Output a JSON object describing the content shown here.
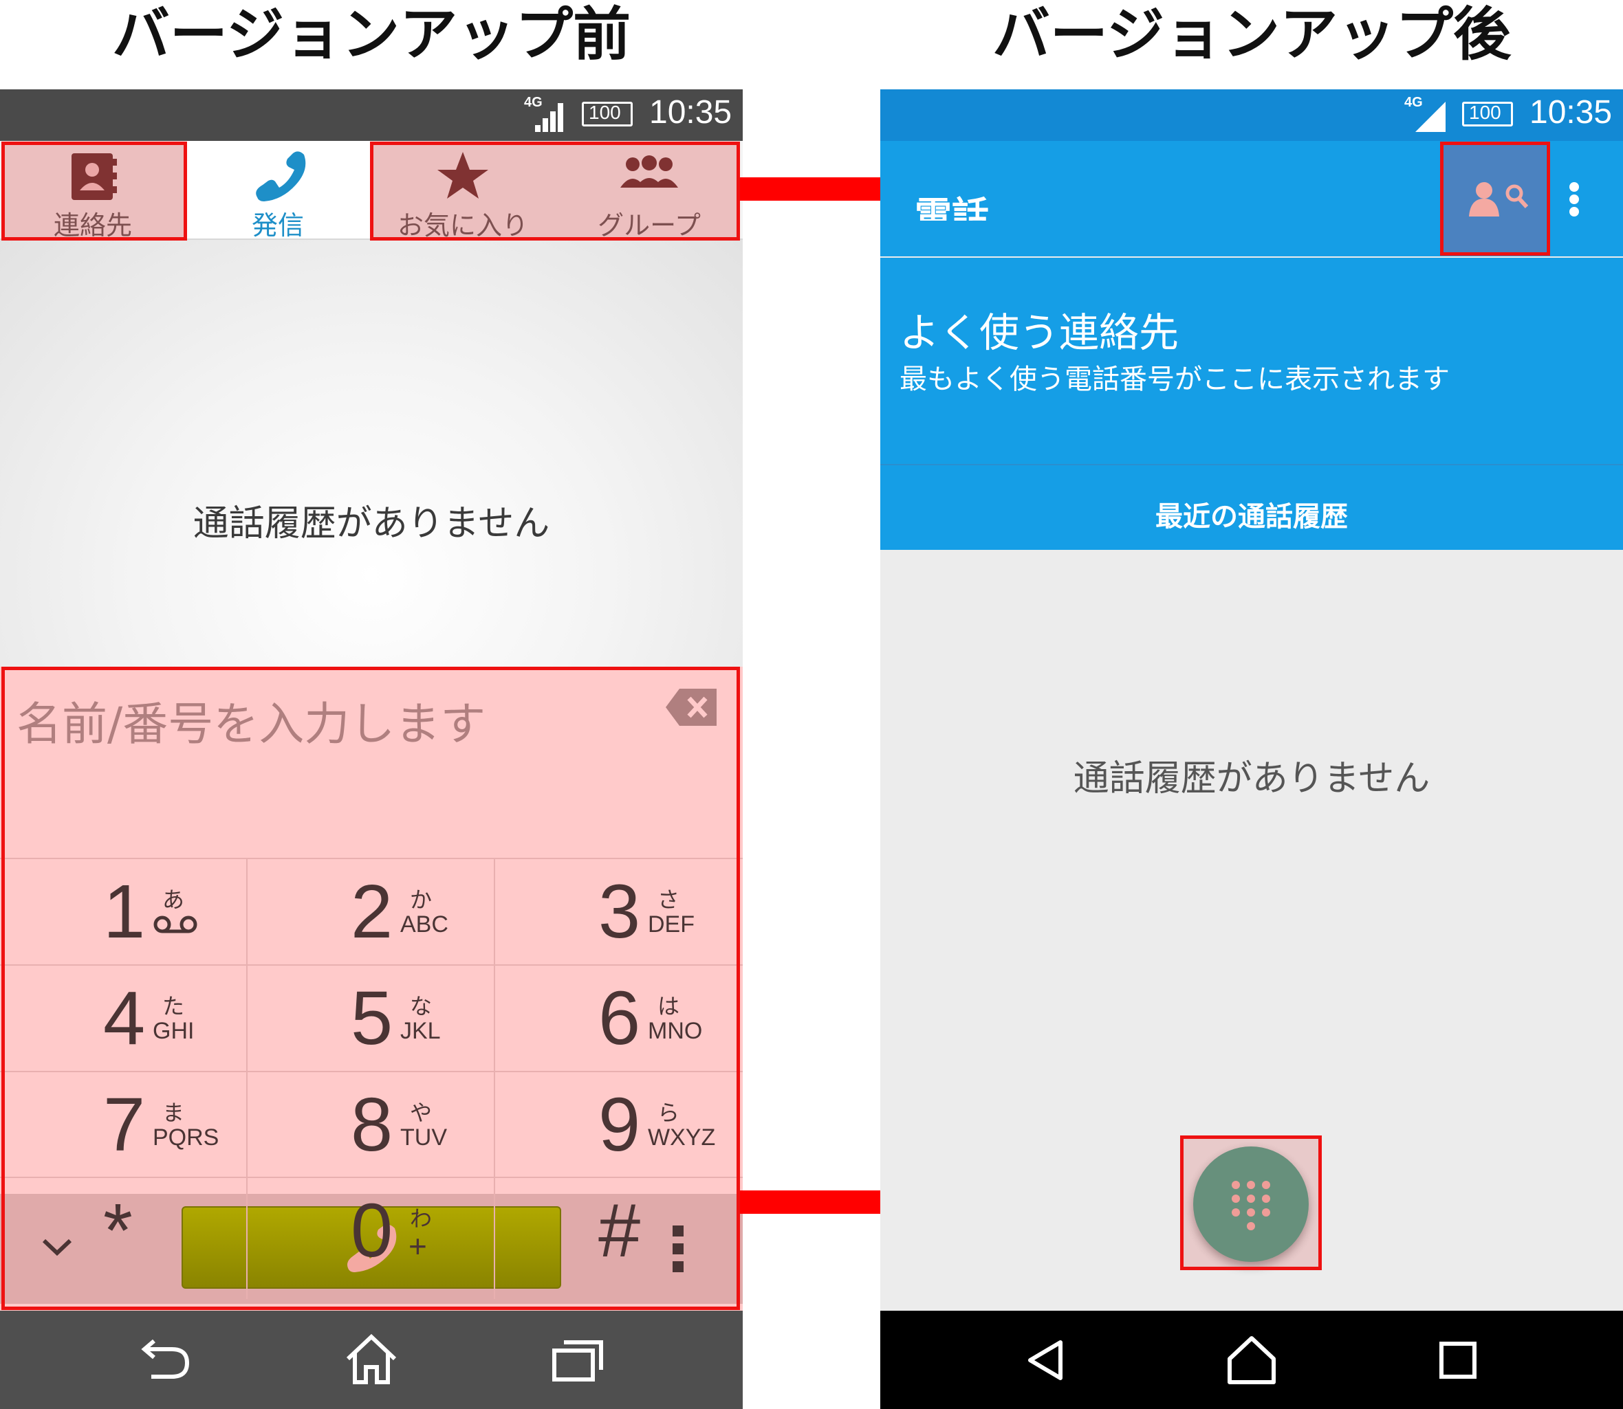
{
  "headings": {
    "before": "バージョンアップ前",
    "after": "バージョンアップ後"
  },
  "status_bar": {
    "network": "4G",
    "battery": "100",
    "time": "10:35"
  },
  "before": {
    "tabs": [
      {
        "label": "連絡先",
        "icon": "contacts-book-icon"
      },
      {
        "label": "発信",
        "icon": "phone-handset-icon"
      },
      {
        "label": "お気に入り",
        "icon": "star-icon"
      },
      {
        "label": "グループ",
        "icon": "group-icon"
      }
    ],
    "empty_message": "通話履歴がありません",
    "dialpad": {
      "placeholder": "名前/番号を入力します",
      "keys": [
        {
          "num": "1",
          "kana": "あ",
          "letters": ""
        },
        {
          "num": "2",
          "kana": "か",
          "letters": "ABC"
        },
        {
          "num": "3",
          "kana": "さ",
          "letters": "DEF"
        },
        {
          "num": "4",
          "kana": "た",
          "letters": "GHI"
        },
        {
          "num": "5",
          "kana": "な",
          "letters": "JKL"
        },
        {
          "num": "6",
          "kana": "は",
          "letters": "MNO"
        },
        {
          "num": "7",
          "kana": "ま",
          "letters": "PQRS"
        },
        {
          "num": "8",
          "kana": "や",
          "letters": "TUV"
        },
        {
          "num": "9",
          "kana": "ら",
          "letters": "WXYZ"
        },
        {
          "num": "*",
          "kana": "",
          "letters": ""
        },
        {
          "num": "0",
          "kana": "わ",
          "letters": "+"
        },
        {
          "num": "#",
          "kana": "",
          "letters": ""
        }
      ]
    }
  },
  "after": {
    "appbar_title": "電話",
    "frequent_title": "よく使う連絡先",
    "frequent_subtitle": "最もよく使う電話番号がここに表示されます",
    "recent_label": "最近の通話履歴",
    "empty_message": "通話履歴がありません"
  },
  "colors": {
    "highlight_border": "#ee1111",
    "arrow": "#ff0000",
    "blue_appbar": "#159ee6",
    "fab": "#4aa38a"
  }
}
